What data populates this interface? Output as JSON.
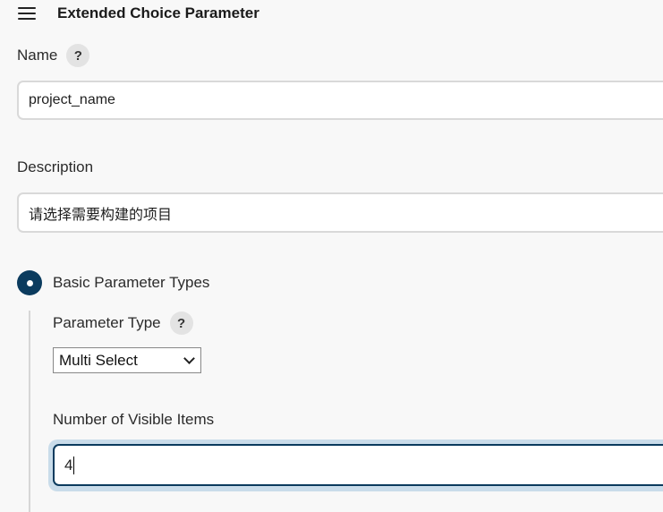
{
  "header": {
    "title": "Extended Choice Parameter",
    "menu_icon": "hamburger-menu-icon"
  },
  "fields": {
    "name": {
      "label": "Name",
      "help": "?",
      "value": "project_name"
    },
    "description": {
      "label": "Description",
      "value": "请选择需要构建的项目"
    }
  },
  "parameter_group": {
    "radio_label": "Basic Parameter Types",
    "radio_selected": true,
    "parameter_type": {
      "label": "Parameter Type",
      "help": "?",
      "selected": "Multi Select"
    },
    "visible_items": {
      "label": "Number of Visible Items",
      "value": "4"
    }
  },
  "colors": {
    "accent": "#0b3b5e",
    "focus_ring": "#c9dcea",
    "background": "#f8f8f8",
    "help_bg": "#e3e3e3"
  }
}
